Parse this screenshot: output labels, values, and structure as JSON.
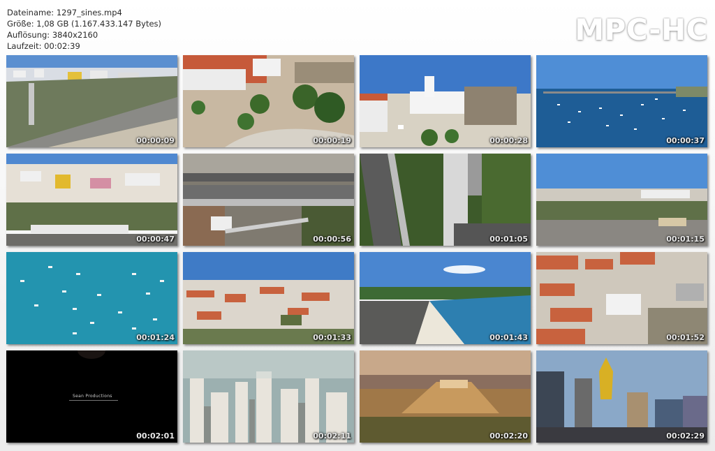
{
  "info": {
    "filename": "Dateiname: 1297_sines.mp4",
    "size": "Größe: 1,08 GB (1.167.433.147 Bytes)",
    "resolution": "Auflösung: 3840x2160",
    "duration": "Laufzeit: 00:02:39"
  },
  "logo": "MPC-HC",
  "thumbs": [
    {
      "time": "00:00:09",
      "scene": "coastal-town-road"
    },
    {
      "time": "00:00:19",
      "scene": "town-plaza-trees"
    },
    {
      "time": "00:00:28",
      "scene": "white-church-square"
    },
    {
      "time": "00:00:37",
      "scene": "harbor-boats"
    },
    {
      "time": "00:00:47",
      "scene": "hillside-houses"
    },
    {
      "time": "00:00:56",
      "scene": "overhead-road"
    },
    {
      "time": "00:01:05",
      "scene": "tower-overhead"
    },
    {
      "time": "00:01:15",
      "scene": "town-panorama"
    },
    {
      "time": "00:01:24",
      "scene": "turquoise-sea-boats"
    },
    {
      "time": "00:01:33",
      "scene": "rooftops-town"
    },
    {
      "time": "00:01:43",
      "scene": "beach-bay"
    },
    {
      "time": "00:01:52",
      "scene": "church-rooftops"
    },
    {
      "time": "00:02:01",
      "scene": "black-credits"
    },
    {
      "time": "00:02:11",
      "scene": "skyscrapers-haze"
    },
    {
      "time": "00:02:20",
      "scene": "acropolis-sunset"
    },
    {
      "time": "00:02:29",
      "scene": "casino-towers"
    }
  ],
  "credits_text": "Sean Productions"
}
